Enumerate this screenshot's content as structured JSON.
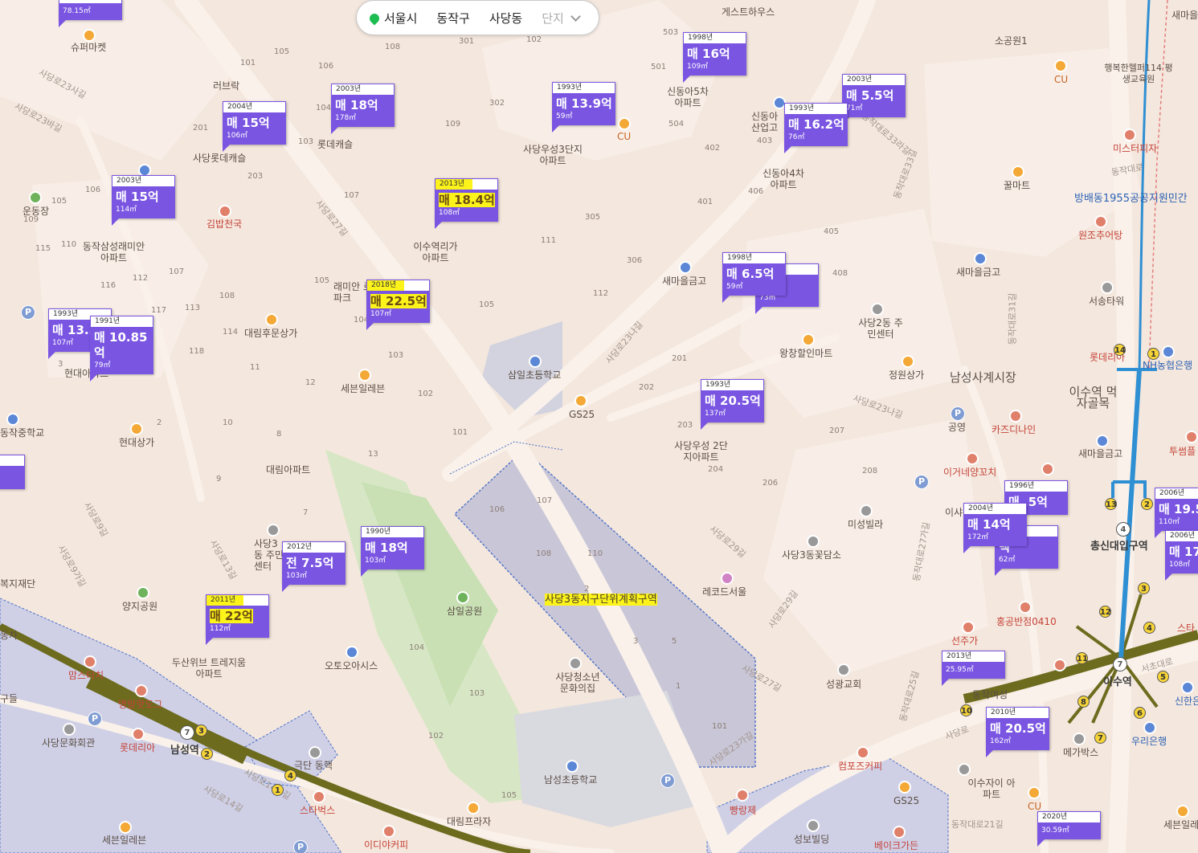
{
  "searchbar": {
    "region": "서울시",
    "district": "동작구",
    "dong": "사당동",
    "complex": "단지"
  },
  "listings": [
    {
      "id": "l0",
      "year": "",
      "price": "",
      "area": "78.15㎡"
    },
    {
      "id": "l1",
      "year": "2004년",
      "price": "매 15억",
      "area": "106㎡"
    },
    {
      "id": "l2",
      "year": "2003년",
      "price": "매 18억",
      "area": "178㎡"
    },
    {
      "id": "l3",
      "year": "1993년",
      "price": "매 13.9억",
      "area": "59㎡"
    },
    {
      "id": "l4",
      "year": "1998년",
      "price": "매 16억",
      "area": "109㎡"
    },
    {
      "id": "l5",
      "year": "2003년",
      "price": "매 5.5억",
      "area": "71㎡"
    },
    {
      "id": "l6",
      "year": "1993년",
      "price": "매 16.2억",
      "area": "76㎡"
    },
    {
      "id": "l7",
      "year": "2003년",
      "price": "매 15억",
      "area": "114㎡"
    },
    {
      "id": "l8",
      "year": "2013년",
      "price": "매 18.4억",
      "area": "108㎡"
    },
    {
      "id": "l9",
      "year": "2018년",
      "price": "매 22.5억",
      "area": "107㎡"
    },
    {
      "id": "l10",
      "year": "1993년",
      "price": "매 13.5억",
      "area": "107㎡"
    },
    {
      "id": "l11",
      "year": "1991년",
      "price": "매 10.85억",
      "area": "79㎡"
    },
    {
      "id": "l12",
      "year": "",
      "price": "억",
      "area": "73㎡"
    },
    {
      "id": "l13",
      "year": "1998년",
      "price": "매 6.5억",
      "area": "59㎡"
    },
    {
      "id": "l14",
      "year": "1993년",
      "price": "매 20.5억",
      "area": "137㎡"
    },
    {
      "id": "l15",
      "year": "",
      "price": "억",
      "area": ""
    },
    {
      "id": "l16",
      "year": "1990년",
      "price": "매 18억",
      "area": "103㎡"
    },
    {
      "id": "l17",
      "year": "2012년",
      "price": "전 7.5억",
      "area": "103㎡"
    },
    {
      "id": "l18",
      "year": "2011년",
      "price": "매 22억",
      "area": "112㎡"
    },
    {
      "id": "l19",
      "year": "1996년",
      "price": "매 .5억",
      "area": ""
    },
    {
      "id": "l20",
      "year": "",
      "price": "백",
      "area": "62㎡"
    },
    {
      "id": "l21",
      "year": "2004년",
      "price": "매 14억",
      "area": "172㎡"
    },
    {
      "id": "l22",
      "year": "2006년",
      "price": "매 19.5억",
      "area": "110㎡"
    },
    {
      "id": "l23",
      "year": "2006년",
      "price": "매 17",
      "area": "108㎡"
    },
    {
      "id": "l24",
      "year": "2013년",
      "price": "",
      "area": "25.95㎡"
    },
    {
      "id": "l25",
      "year": "2010년",
      "price": "매 20.5억",
      "area": "162㎡"
    },
    {
      "id": "l26",
      "year": "2020년",
      "price": "",
      "area": "30.59㎡"
    }
  ],
  "places": {
    "supermarket": "슈퍼마켓",
    "rubrack": "러브락",
    "lotte_castle1": "사당롯데캐슬",
    "lotte_castle2": "롯데캐슬",
    "woosung3": "사당우성3단지 아파트",
    "cu1": "CU",
    "shindong5": "신동아5차 아파트",
    "shindong_biz": "신동아 산업고",
    "shindong4": "신동아4차 아파트",
    "guesthouse": "게스트하우스",
    "sogongwon": "소공원1",
    "cu2": "CU",
    "hangbok": "행복한헬퍼114 평생교육원",
    "mistpizza": "미스터피자",
    "kkulmart": "꿀마트",
    "bangbae": "방배동1955공공지원민간",
    "wonjo": "원조추어탕",
    "saemaeul_kg1": "새마을금고",
    "saemaeul_kg2": "새마을금고",
    "seosung": "서송타워",
    "saemaeul_kg3": "새마을금고",
    "saemaeul_kg4": "새마을금고",
    "sadang2": "사당2동 주민센터",
    "wangchang": "왕창할인마트",
    "jungwon": "정원상가",
    "namsung_market": "남성사계시장",
    "isu_food": "이수역 먹자골목",
    "nh": "NH농협은행",
    "lotteria1": "롯데리아",
    "park_gongyoung": "공영",
    "cadinaine": "카즈디나인",
    "igeone": "이거네양꼬치",
    "tusseom": "투썸플",
    "undongjang": "운동장",
    "kimbap": "김밥천국",
    "samsung_raemian": "동작삼성래미안 아파트",
    "raemian_lobby": "래미안 로이파크",
    "isu_rica": "이수역리가 아파트",
    "daerim_mun": "대림후문상가",
    "sevenel1": "세븐일레븐",
    "samil_school": "삼일초등학교",
    "gs25a": "GS25",
    "hyundai_apt": "현대아파트",
    "dongjak_mid": "동작중학교",
    "hyundai_mall": "현대상가",
    "daerim_apt": "대림아파트",
    "woosung2": "사당우성 2단지아파트",
    "sadang3_center": "사당3동 주민센터",
    "yangji": "양지공원",
    "samil_park": "삼일공원",
    "plan_zone": "사당3동지구단위계획구역",
    "doosan": "두산위브 트레지움아파트",
    "otoo": "오토오아시스",
    "youth": "사당청소년 문화의집",
    "miseong": "미성빌라",
    "sadang3_flower": "사당3동꽃담소",
    "record": "레코드서울",
    "seongwang": "성광교회",
    "seonjuga": "선주가",
    "honggong": "홍공반점0410",
    "donjak_women": "동작여성",
    "chongsin": "총신대입구역",
    "isu_station": "이수역",
    "woori": "우리은행",
    "shinhan": "신한은",
    "megabox": "메가박스",
    "isu_xi": "이수자이 아파트",
    "cu3": "CU",
    "sevenel2": "세븐일레",
    "momstouch": "맘스터치",
    "myungrang": "명랑핫도그",
    "sadang_culture": "사당문화회관",
    "lotteria2": "롯데리아",
    "namsung_station": "남성역",
    "geukdan": "극단 동핵",
    "starbucks": "스타벅스",
    "sevenel3": "세븐일레븐",
    "idea": "이디야커피",
    "daerim_plaza": "대림프라자",
    "namsung_school": "남성초등학교",
    "ppang": "빵랑제",
    "compose": "컴포즈커피",
    "gs25b": "GS25",
    "seongbo": "성보빌딩",
    "bakery": "베이크가든",
    "welfare": "복지재단",
    "samgyup": "이샤",
    "dongtae": "동차",
    "starbucks2": "스타",
    "l_hangul": "구들"
  },
  "roads": {
    "r1": "사당로23사길",
    "r2": "사당로23바길",
    "r3": "사당로27길",
    "r4": "사당로23나길",
    "r5": "사당로23나길",
    "r6": "사당로29길",
    "r7": "사당로29길",
    "r8": "사당로27길",
    "r9": "사당로23가길",
    "r10": "사당로13길",
    "r11": "사당로9길",
    "r12": "사당로14가길",
    "r13": "동작대로",
    "r14": "동작대로31길",
    "r15": "동작대로33길",
    "r16": "동작대로33라길",
    "r17": "동작대로27가길",
    "r18": "동작대로25길",
    "r19": "사당로",
    "r20": "동작대로21길",
    "r21": "서초대로",
    "r22": "사당로14길",
    "r23": "사당로9가길"
  },
  "numbers": [
    "301",
    "108",
    "102",
    "105",
    "106",
    "101",
    "104",
    "201",
    "103",
    "203",
    "302",
    "109",
    "503",
    "501",
    "504",
    "402",
    "403",
    "401",
    "406",
    "405",
    "408",
    "305",
    "111",
    "306",
    "112",
    "201",
    "202",
    "207",
    "208",
    "206",
    "204",
    "203",
    "116",
    "112",
    "107",
    "117",
    "113",
    "118",
    "108",
    "114",
    "105",
    "110",
    "115",
    "109",
    "105",
    "11",
    "12",
    "10",
    "8",
    "9",
    "7",
    "13",
    "2",
    "3",
    "101",
    "102",
    "103",
    "104",
    "105",
    "106",
    "107",
    "108",
    "110",
    "2",
    "3",
    "5",
    "1",
    "101",
    "102",
    "103",
    "104",
    "105",
    "106",
    "107"
  ],
  "colors": {
    "listing": "#7a55e2",
    "highlight": "#fbf31a",
    "line2": "#2f8fd3",
    "line7": "#6d6b1e",
    "line4": "#2d8fd3"
  }
}
